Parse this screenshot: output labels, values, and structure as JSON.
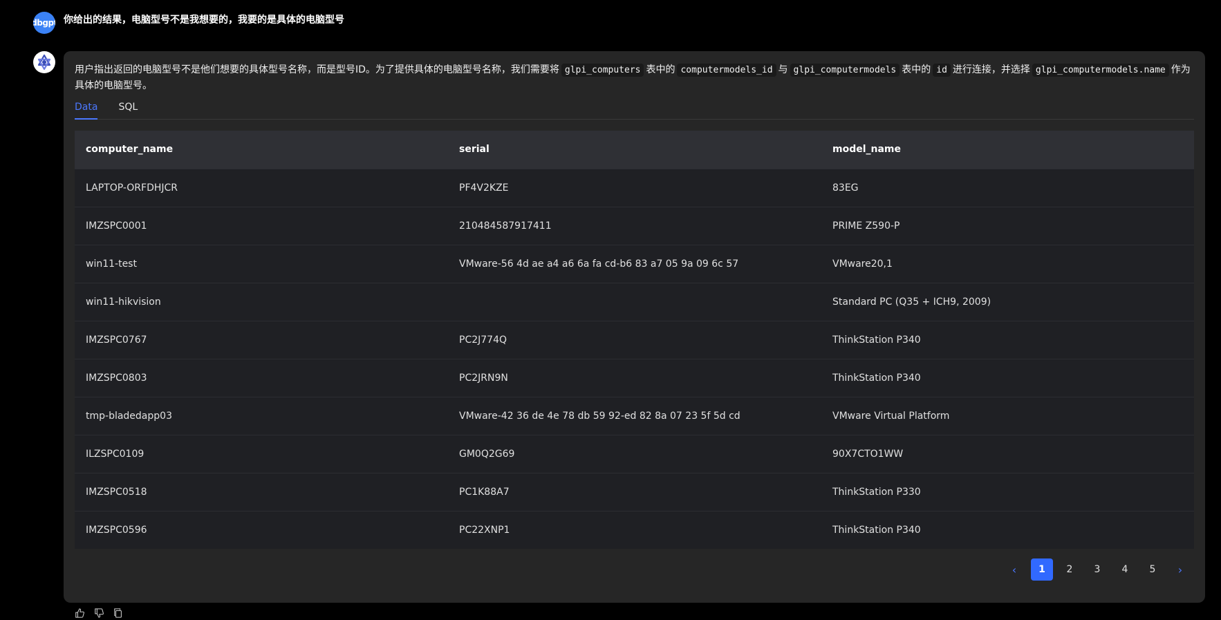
{
  "user": {
    "avatar_label": "dbgpt",
    "message": "你给出的结果，电脑型号不是我想要的，我要的是具体的电脑型号"
  },
  "assistant": {
    "intro_parts": [
      {
        "text": "用户指出返回的电脑型号不是他们想要的具体型号名称，而是型号ID。为了提供具体的电脑型号名称，我们需要将",
        "code": false
      },
      {
        "text": "glpi_computers",
        "code": true
      },
      {
        "text": "表中的",
        "code": false
      },
      {
        "text": "computermodels_id",
        "code": true
      },
      {
        "text": "与",
        "code": false
      },
      {
        "text": "glpi_computermodels",
        "code": true
      },
      {
        "text": "表中的",
        "code": false
      },
      {
        "text": "id",
        "code": true
      },
      {
        "text": "进行连接，并选择",
        "code": false
      },
      {
        "text": "glpi_computermodels.name",
        "code": true
      },
      {
        "text": "作为具体的电脑型号。",
        "code": false
      }
    ],
    "tabs": [
      {
        "label": "Data",
        "active": true
      },
      {
        "label": "SQL",
        "active": false
      }
    ],
    "table": {
      "columns": [
        "computer_name",
        "serial",
        "model_name"
      ],
      "rows": [
        [
          "LAPTOP-ORFDHJCR",
          "PF4V2KZE",
          "83EG"
        ],
        [
          "IMZSPC0001",
          "210484587917411",
          "PRIME Z590-P"
        ],
        [
          "win11-test",
          "VMware-56 4d ae a4 a6 6a fa cd-b6 83 a7 05 9a 09 6c 57",
          "VMware20,1"
        ],
        [
          "win11-hikvision",
          "",
          "Standard PC (Q35 + ICH9, 2009)"
        ],
        [
          "IMZSPC0767",
          "PC2J774Q",
          "ThinkStation P340"
        ],
        [
          "IMZSPC0803",
          "PC2JRN9N",
          "ThinkStation P340"
        ],
        [
          "tmp-bladedapp03",
          "VMware-42 36 de 4e 78 db 59 92-ed 82 8a 07 23 5f 5d cd",
          "VMware Virtual Platform"
        ],
        [
          "ILZSPC0109",
          "GM0Q2G69",
          "90X7CTO1WW"
        ],
        [
          "IMZSPC0518",
          "PC1K88A7",
          "ThinkStation P330"
        ],
        [
          "IMZSPC0596",
          "PC22XNP1",
          "ThinkStation P340"
        ]
      ]
    },
    "pagination": {
      "prev_icon": "chevron-left-icon",
      "next_icon": "chevron-right-icon",
      "pages": [
        "1",
        "2",
        "3",
        "4",
        "5"
      ],
      "current": "1"
    },
    "actions": [
      "thumbs-up-icon",
      "thumbs-down-icon",
      "copy-icon"
    ]
  },
  "colors": {
    "accent": "#3169ff",
    "bubble": "#262626",
    "background": "#000000"
  }
}
